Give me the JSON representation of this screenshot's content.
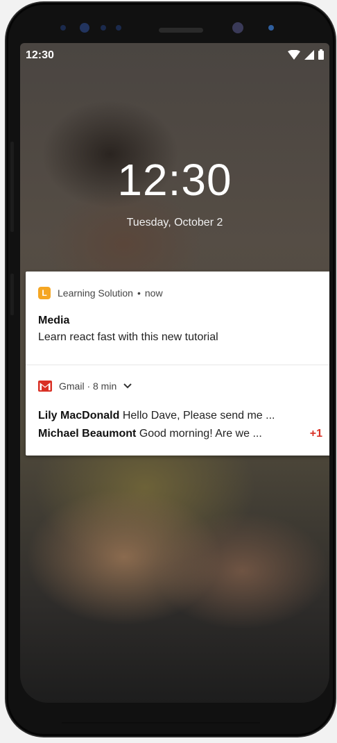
{
  "status_bar": {
    "time": "12:30"
  },
  "lock_screen": {
    "clock": "12:30",
    "date": "Tuesday, October 2"
  },
  "notifications": [
    {
      "app_icon_letter": "L",
      "app_name": "Learning Solution",
      "separator": "•",
      "time": "now",
      "title": "Media",
      "body": "Learn react fast with this new tutorial"
    },
    {
      "app_icon": "gmail-icon",
      "header": "Gmail · 8 min",
      "messages": [
        {
          "sender": "Lily MacDonald",
          "snippet": "Hello Dave,  Please send me  ..."
        },
        {
          "sender": "Michael Beaumont",
          "snippet": "Good morning! Are we ..."
        }
      ],
      "more_count": "+1"
    }
  ],
  "colors": {
    "accent_orange": "#f5a623",
    "gmail_red": "#d93025"
  }
}
